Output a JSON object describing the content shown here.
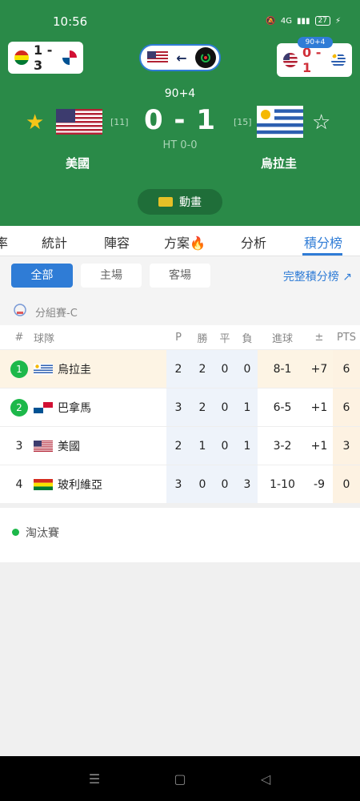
{
  "status": {
    "time": "10:56",
    "battery": "27",
    "network": "4G"
  },
  "header": {
    "mini_left": {
      "score": "1 - 3"
    },
    "mini_right": {
      "score": "0 - 1",
      "badge": "90+4"
    },
    "minute": "90+4",
    "score": "0 - 1",
    "halftime": "HT 0-0",
    "home": {
      "name": "美國",
      "rank": "[11]",
      "favorite": true
    },
    "away": {
      "name": "烏拉圭",
      "rank": "[15]",
      "favorite": false
    },
    "animation_label": "動畫"
  },
  "tabs": [
    {
      "label": "率",
      "active": false
    },
    {
      "label": "統計",
      "active": false
    },
    {
      "label": "陣容",
      "active": false
    },
    {
      "label": "方案🔥",
      "active": false
    },
    {
      "label": "分析",
      "active": false
    },
    {
      "label": "積分榜",
      "active": true
    }
  ],
  "filters": {
    "all": "全部",
    "home": "主場",
    "away": "客場",
    "full_link": "完整積分榜 ↗"
  },
  "group": {
    "label": "分組賽-C"
  },
  "table": {
    "headers": {
      "rank": "#",
      "team": "球隊",
      "p": "P",
      "w": "勝",
      "d": "平",
      "l": "負",
      "goals": "進球",
      "diff": "±",
      "pts": "PTS"
    },
    "rows": [
      {
        "rank": "1",
        "team": "烏拉圭",
        "flag": "uruguay",
        "p": "2",
        "w": "2",
        "d": "0",
        "l": "0",
        "goals": "8-1",
        "diff": "+7",
        "pts": "6",
        "qualified": true
      },
      {
        "rank": "2",
        "team": "巴拿馬",
        "flag": "panama",
        "p": "3",
        "w": "2",
        "d": "0",
        "l": "1",
        "goals": "6-5",
        "diff": "+1",
        "pts": "6",
        "qualified": true
      },
      {
        "rank": "3",
        "team": "美國",
        "flag": "usa",
        "p": "2",
        "w": "1",
        "d": "0",
        "l": "1",
        "goals": "3-2",
        "diff": "+1",
        "pts": "3",
        "qualified": false
      },
      {
        "rank": "4",
        "team": "玻利維亞",
        "flag": "bolivia",
        "p": "3",
        "w": "0",
        "d": "0",
        "l": "3",
        "goals": "1-10",
        "diff": "-9",
        "pts": "0",
        "qualified": false
      }
    ]
  },
  "knockout": {
    "label": "淘汰賽"
  },
  "colors": {
    "header_green": "#2a8a48",
    "accent_blue": "#2f7cd6",
    "qualify_green": "#1db84a"
  }
}
